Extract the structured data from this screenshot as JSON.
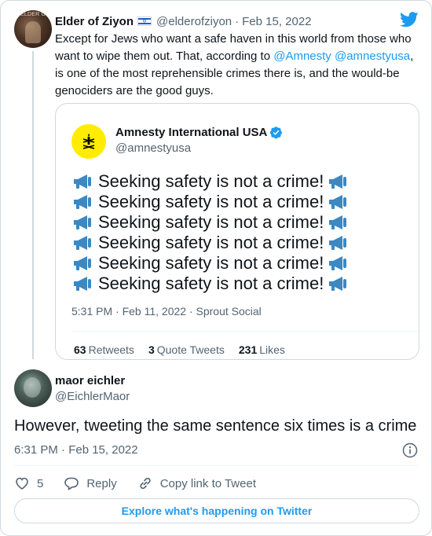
{
  "parent": {
    "name": "Elder of Ziyon",
    "avatar_text": "ELDER OF",
    "handle": "@elderofziyon",
    "separator": "·",
    "date": "Feb 15, 2022",
    "body": {
      "part1": "Except for Jews who want a safe haven in this world from those who want to wipe them out. That, according to ",
      "mention1": "@Amnesty",
      "between": " ",
      "mention2": "@amnestyusa",
      "part2": ", is one of the most reprehensible crimes there is, and the would-be genociders are the good guys."
    }
  },
  "quoted": {
    "name": "Amnesty International USA",
    "handle": "@amnestyusa",
    "lines": [
      "Seeking safety is not a crime!",
      "Seeking safety is not a crime!",
      "Seeking safety is not a crime!",
      "Seeking safety is not a crime!",
      "Seeking safety is not a crime!",
      "Seeking safety is not a crime!"
    ],
    "timestamp": "5:31 PM · Feb 11, 2022 · Sprout Social",
    "stats": {
      "retweets_count": "63",
      "retweets_label": "Retweets",
      "quotes_count": "3",
      "quotes_label": "Quote Tweets",
      "likes_count": "231",
      "likes_label": "Likes"
    }
  },
  "reply": {
    "name": "maor eichler",
    "handle": "@EichlerMaor",
    "text": "However, tweeting the same sentence six times is a crime",
    "timestamp": "6:31 PM · Feb 15, 2022"
  },
  "actions": {
    "like_count": "5",
    "reply_label": "Reply",
    "copy_label": "Copy link to Tweet"
  },
  "explore_label": "Explore what's happening on Twitter",
  "colors": {
    "accent": "#1d9bf0",
    "text": "#0f1419",
    "muted": "#536471",
    "border": "#cfd9de",
    "amnesty_yellow": "#ffec00",
    "megaphone_blue": "#3b88c3"
  },
  "icons": [
    "twitter-bird-icon",
    "israel-flag-icon",
    "verified-badge-icon",
    "megaphone-icon",
    "info-icon",
    "heart-icon",
    "reply-bubble-icon",
    "link-icon",
    "amnesty-candle-logo"
  ]
}
